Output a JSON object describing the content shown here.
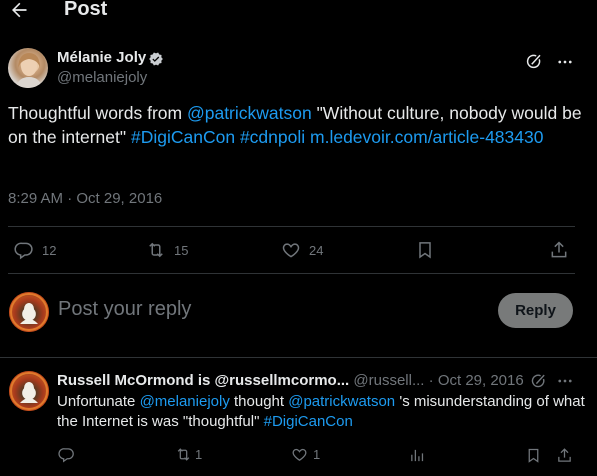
{
  "header": {
    "title": "Post",
    "back_icon": "arrow-left-icon"
  },
  "author": {
    "name": "Mélanie Joly",
    "handle": "@melaniejoly",
    "verified": true
  },
  "tweet": {
    "text_1": "Thoughtful words from ",
    "mention_1": "@patrickwatson",
    "text_2": " \"Without culture, nobody would be on the internet\" ",
    "hashtag_1": "#DigiCanCon",
    "space_1": " ",
    "hashtag_2": "#cdnpoli",
    "space_2": " ",
    "link": "m.ledevoir.com/article-483430",
    "timestamp": "8:29 AM · Oct 29, 2016"
  },
  "actions": {
    "replies": "12",
    "reposts": "15",
    "likes": "24"
  },
  "reply_box": {
    "placeholder": "Post your reply",
    "button": "Reply"
  },
  "reply": {
    "name": "Russell McOrmond is @russellmcormo...",
    "handle": "@russell...",
    "dot": "·",
    "date": "Oct 29, 2016",
    "text_1": "Unfortunate ",
    "mention_1": "@melaniejoly",
    "text_2": " thought ",
    "mention_2": "@patrickwatson",
    "text_3": " 's misunderstanding of what the Internet is was \"thoughtful\" ",
    "hashtag_1": "#DigiCanCon",
    "replies": "",
    "reposts": "1",
    "likes": "1"
  },
  "colors": {
    "background": "#000000",
    "text": "#e7e9ea",
    "muted": "#71767b",
    "accent": "#1d9bf0",
    "divider": "#2f3336",
    "reply_button_bg": "#787a7a"
  }
}
